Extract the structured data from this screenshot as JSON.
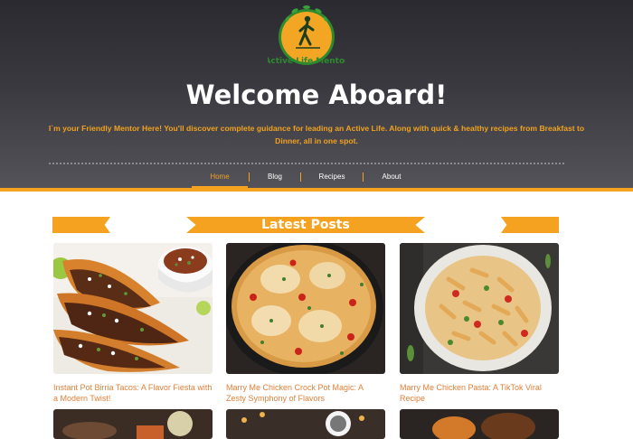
{
  "header": {
    "logo_text": "Active Life Mentor",
    "title": "Welcome Aboard!",
    "tagline": "I`m your Friendly Mentor Here! You'll discover complete guidance for leading an Active Life. Along with quick & healthy recipes from Breakfast to Dinner, all in one spot."
  },
  "nav": {
    "items": [
      {
        "label": "Home",
        "active": true
      },
      {
        "label": "Blog",
        "active": false
      },
      {
        "label": "Recipes",
        "active": false
      },
      {
        "label": "About",
        "active": false
      }
    ]
  },
  "section": {
    "title": "Latest Posts"
  },
  "posts": [
    {
      "title": "Instant Pot Birria Tacos: A Flavor Fiesta with a Modern Twist!",
      "image": "birria-tacos-photo"
    },
    {
      "title": "Marry Me Chicken Crock Pot Magic: A Zesty Symphony of Flavors",
      "image": "chicken-skillet-photo"
    },
    {
      "title": "Marry Me Chicken Pasta: A TikTok Viral Recipe",
      "image": "chicken-pasta-photo"
    }
  ],
  "colors": {
    "accent": "#f4a21f",
    "header_dark": "#2b2a30",
    "link": "#e0813a"
  }
}
